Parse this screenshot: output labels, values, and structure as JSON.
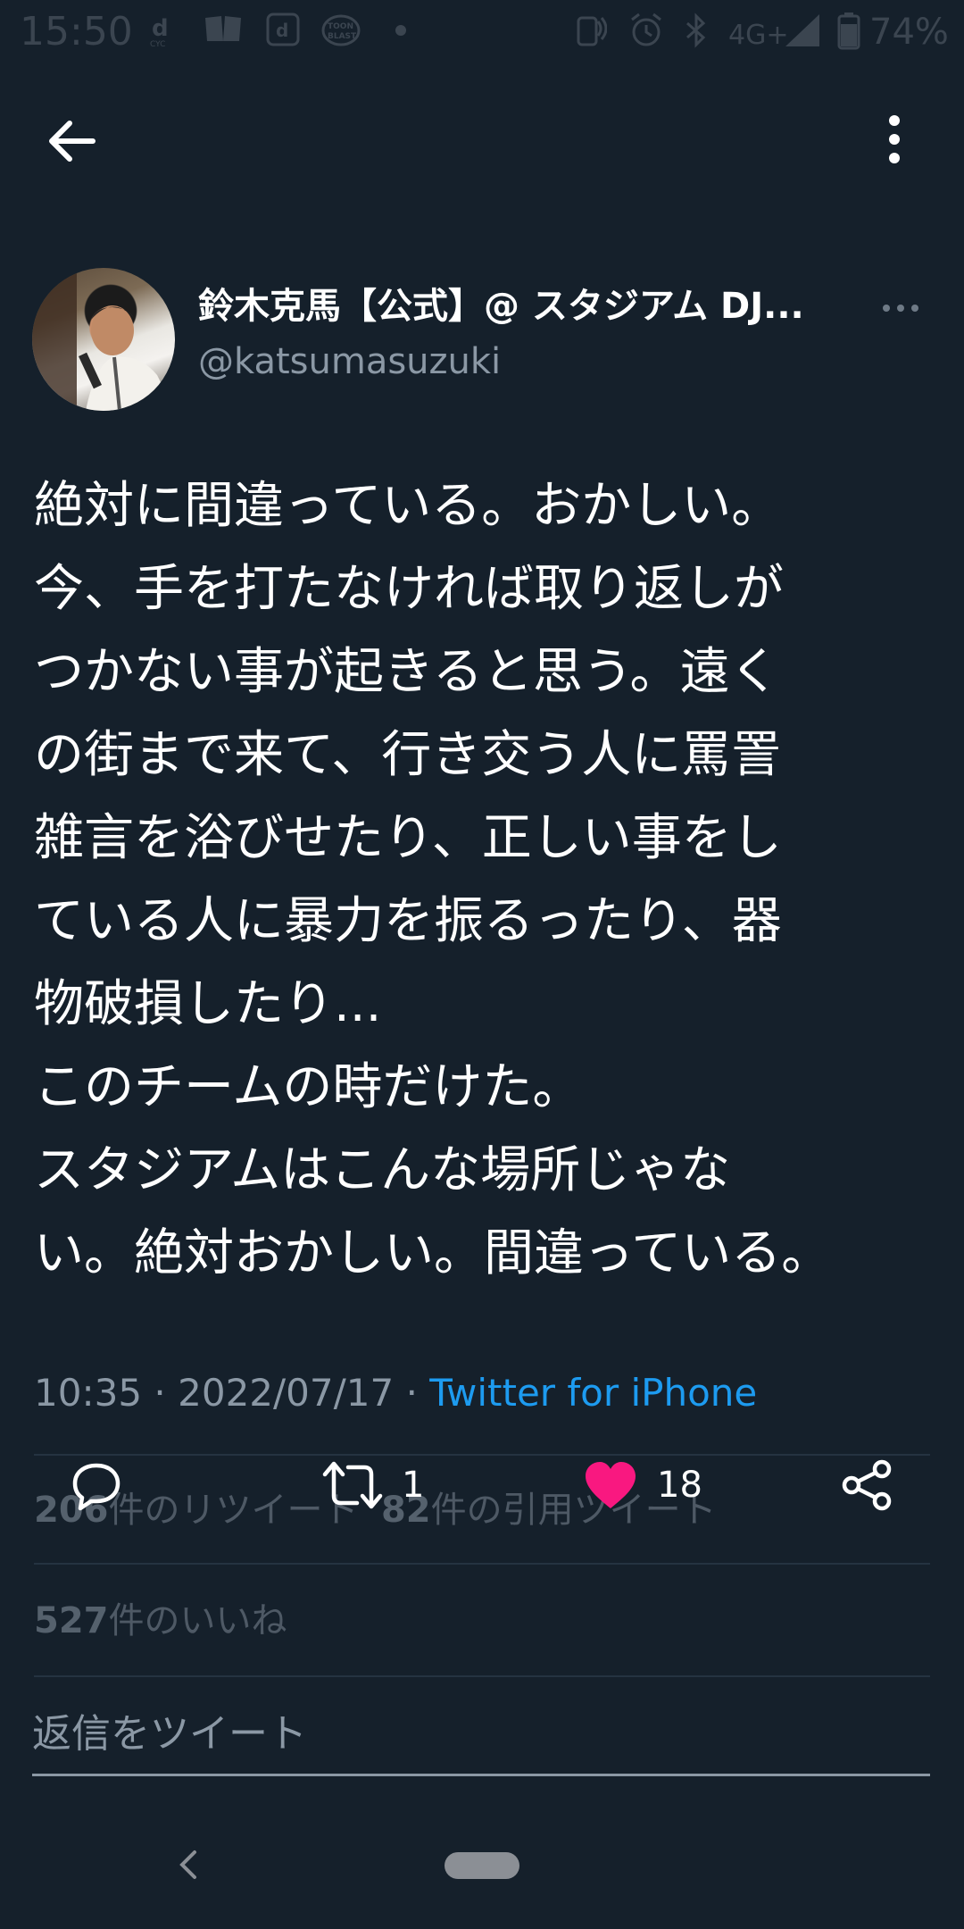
{
  "status_bar": {
    "time": "15:50",
    "network": "4G+",
    "battery": "74%",
    "left_icons": [
      "docomo-d-icon",
      "book-icon",
      "d-app-icon",
      "toon-blast-icon",
      "dot-icon"
    ],
    "right_icons": [
      "nfc-icon",
      "alarm-icon",
      "bluetooth-icon",
      "signal-icon",
      "battery-icon"
    ]
  },
  "app_bar": {
    "back_icon": "arrow-left-icon",
    "menu_icon": "vertical-dots-icon"
  },
  "tweet": {
    "author_name": "鈴木克馬【公式】@ スタジアム DJ...",
    "author_handle": "@katsumasuzuki",
    "text": "絶対に間違っている。おかしい。\n今、手を打たなければ取り返しが\nつかない事が起きると思う。遠く\nの街まで来て、行き交う人に罵詈\n雑言を浴びせたり、正しい事をし\nている人に暴力を振るったり、器\n物破損したり...\nこのチームの時だけた。\nスタジアムはこんな場所じゃな\nい。絶対おかしい。間違っている。",
    "time": "10:35",
    "sep1": "·",
    "date": "2022/07/17",
    "sep2": "·",
    "source": "Twitter for iPhone"
  },
  "stats": {
    "retweets_count": "206",
    "retweets_label": "件のリツイート",
    "quotes_count": "82",
    "quotes_label": "件の引用ツイート",
    "likes_count": "527",
    "likes_label": "件のいいね"
  },
  "actions": {
    "reply_count": "",
    "retweet_count": "1",
    "like_count": "18",
    "like_color": "#f91880"
  },
  "reply_box": {
    "placeholder": "返信をツイート"
  },
  "colors": {
    "background": "#15202b",
    "accent": "#1d9bf0",
    "muted": "#8b98a5"
  }
}
